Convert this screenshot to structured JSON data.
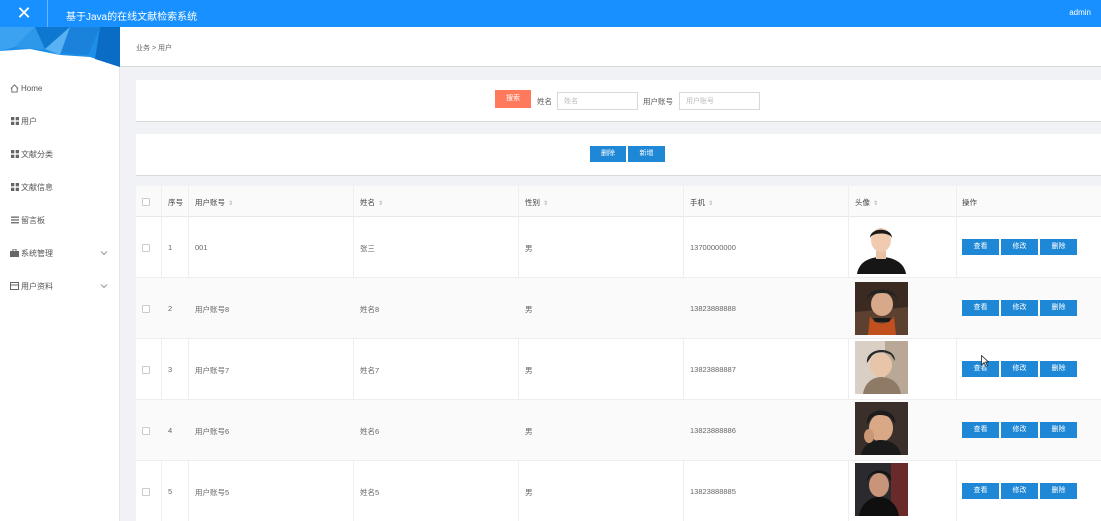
{
  "header": {
    "title": "基于Java的在线文献检索系统",
    "user": "admin",
    "close_icon": "close-icon"
  },
  "sidebar": {
    "items": [
      {
        "label": "Home",
        "icon": "home-icon"
      },
      {
        "label": "用户",
        "icon": "grid-icon"
      },
      {
        "label": "文献分类",
        "icon": "grid-icon"
      },
      {
        "label": "文献信息",
        "icon": "grid-icon"
      },
      {
        "label": "留言板",
        "icon": "list-icon"
      },
      {
        "label": "系统管理",
        "icon": "briefcase-icon",
        "expandable": true
      },
      {
        "label": "用户资料",
        "icon": "card-icon",
        "expandable": true
      }
    ]
  },
  "breadcrumb": {
    "text": "业务 > 用户"
  },
  "search": {
    "button": "搜索",
    "name_label": "姓名",
    "name_placeholder": "姓名",
    "account_label": "用户账号",
    "account_placeholder": "用户账号"
  },
  "actions": {
    "delete": "删除",
    "add": "新增"
  },
  "table": {
    "columns": [
      "序号",
      "用户账号",
      "姓名",
      "性别",
      "手机",
      "头像",
      "操作"
    ],
    "ops": {
      "view": "查看",
      "edit": "修改",
      "delete": "删除"
    },
    "rows": [
      {
        "index": "1",
        "account": "001",
        "name": "张三",
        "gender": "男",
        "phone": "13700000000"
      },
      {
        "index": "2",
        "account": "用户账号8",
        "name": "姓名8",
        "gender": "男",
        "phone": "13823888888"
      },
      {
        "index": "3",
        "account": "用户账号7",
        "name": "姓名7",
        "gender": "男",
        "phone": "13823888887"
      },
      {
        "index": "4",
        "account": "用户账号6",
        "name": "姓名6",
        "gender": "男",
        "phone": "13823888886"
      },
      {
        "index": "5",
        "account": "用户账号5",
        "name": "姓名5",
        "gender": "男",
        "phone": "13823888885"
      }
    ]
  },
  "colors": {
    "primary": "#1890ff",
    "button_blue": "#1e88d6",
    "search_button": "#ff7a5c"
  }
}
